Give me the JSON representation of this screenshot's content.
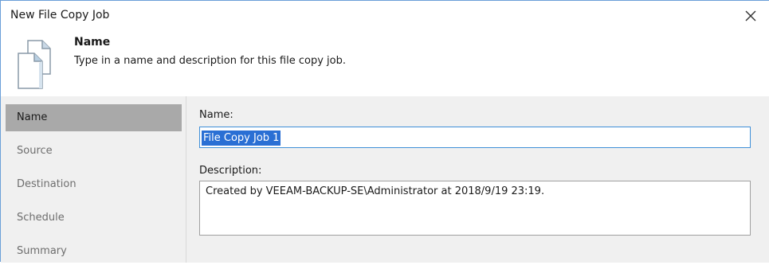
{
  "window": {
    "title": "New File Copy Job"
  },
  "header": {
    "title": "Name",
    "description": "Type in a name and description for this file copy job.",
    "icon": "document-copy-icon"
  },
  "sidebar": {
    "items": [
      {
        "label": "Name",
        "active": true
      },
      {
        "label": "Source",
        "active": false
      },
      {
        "label": "Destination",
        "active": false
      },
      {
        "label": "Schedule",
        "active": false
      },
      {
        "label": "Summary",
        "active": false
      }
    ]
  },
  "form": {
    "name_label": "Name:",
    "name_value": "File Copy Job 1",
    "description_label": "Description:",
    "description_value": "Created by VEEAM-BACKUP-SE\\Administrator at 2018/9/19 23:19."
  },
  "colors": {
    "accent": "#2a6fd4",
    "selection_bg": "#2a6fd4",
    "sidebar_active": "#a9a9a9",
    "panel_bg": "#f0f0f0"
  }
}
